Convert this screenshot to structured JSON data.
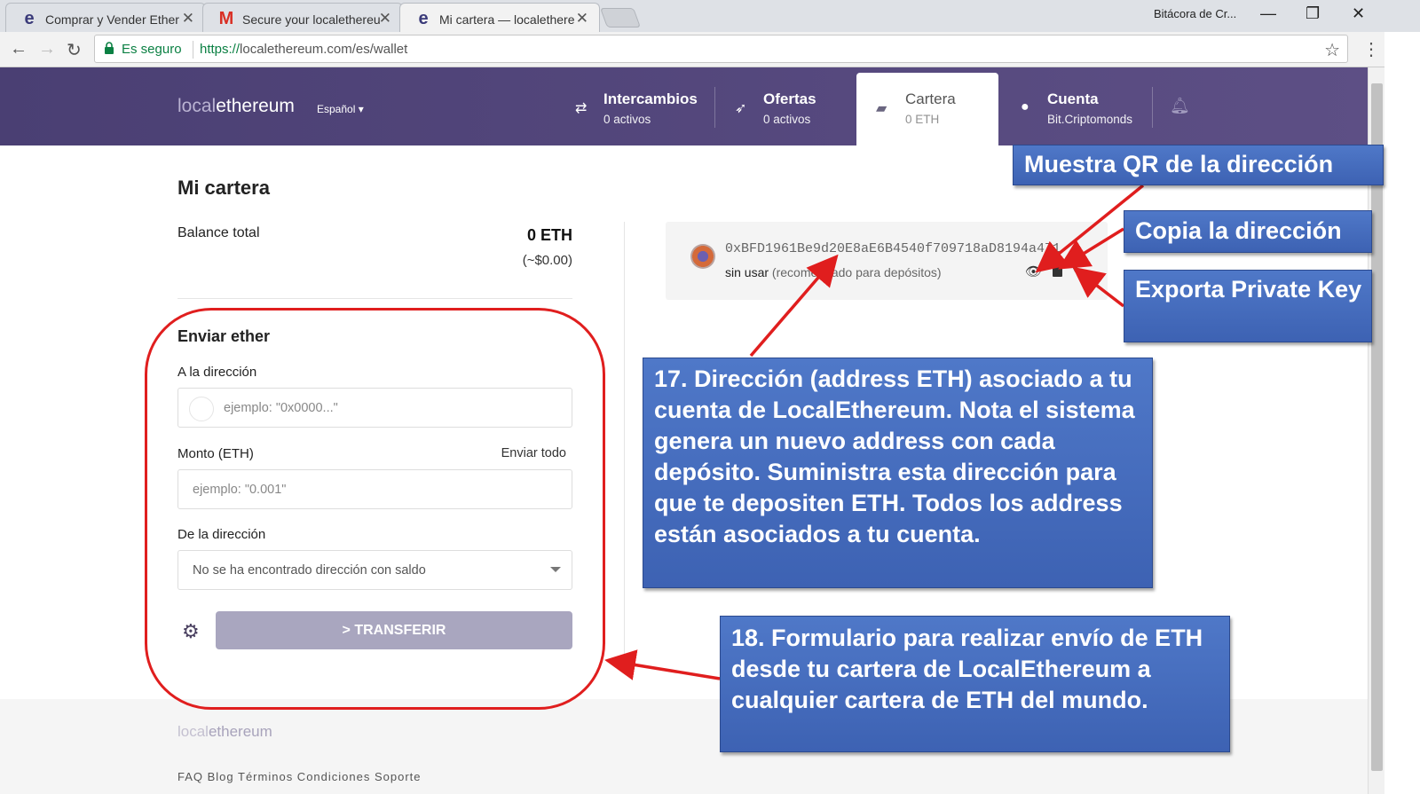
{
  "browser": {
    "tabs": [
      {
        "favicon": "e",
        "title": "Comprar y Vender Ether",
        "close": "✕"
      },
      {
        "favicon": "M",
        "title": "Secure your localethereu",
        "close": "✕"
      },
      {
        "favicon": "e",
        "title": "Mi cartera — localethere",
        "close": "✕"
      }
    ],
    "profile": "Bitácora de Cr...",
    "window_controls": {
      "minimize": "—",
      "restore": "❐",
      "close": "✕"
    },
    "secure_label": "Es seguro",
    "url_scheme": "https://",
    "url_rest": "localethereum.com/es/wallet"
  },
  "site": {
    "logo_local": "local",
    "logo_ethereum": "ethereum",
    "language": "Español ▾",
    "nav": {
      "trades_title": "Intercambios",
      "trades_sub": "0 activos",
      "offers_title": "Ofertas",
      "offers_sub": "0 activos",
      "wallet_title": "Cartera",
      "wallet_sub": "0 ETH",
      "account_title": "Cuenta",
      "account_sub": "Bit.Criptomonds"
    }
  },
  "wallet": {
    "title": "Mi cartera",
    "balance_label": "Balance total",
    "balance_value": "0 ETH",
    "balance_usd": "(~$0.00)",
    "send_title": "Enviar ether",
    "to_label": "A la dirección",
    "to_placeholder": "ejemplo: \"0x0000...\"",
    "amount_label": "Monto (ETH)",
    "send_all": "Enviar todo",
    "amount_placeholder": "ejemplo: \"0.001\"",
    "from_label": "De la dirección",
    "from_value": "No se ha encontrado dirección con saldo",
    "transfer_button": "> TRANSFERIR"
  },
  "address_card": {
    "address": "0xBFD1961Be9d20E8aE6B4540f709718aD8194a471",
    "status": "sin usar",
    "note": "(recomendado para depósitos)"
  },
  "footer": {
    "logo_local": "local",
    "logo_ethereum": "ethereum",
    "links": "FAQ   Blog   Términos   Condiciones   Soporte"
  },
  "annotations": {
    "qr": "Muestra QR de la dirección",
    "copy": "Copia la dirección",
    "export": "Exporta Private Key",
    "note17": "17. Dirección (address ETH) asociado a tu cuenta de LocalEthereum. Nota el sistema genera un nuevo address con cada depósito. Suministra esta dirección para que te depositen ETH. Todos los address están asociados a tu cuenta.",
    "note18": "18. Formulario para realizar envío de ETH desde tu cartera de LocalEthereum a cualquier cartera de ETH del mundo."
  },
  "colors": {
    "header": "#4a3f73",
    "accent_red": "#e01e1e",
    "callout_blue": "#4470c4",
    "button": "#a9a6bf",
    "secure_green": "#0b8043"
  },
  "icons": [
    "trades-icon",
    "offers-icon",
    "wallet-icon",
    "account-icon",
    "bell-icon",
    "gear-icon",
    "eye-icon",
    "copy-icon",
    "chevron-down-icon",
    "lock-icon",
    "star-icon"
  ]
}
